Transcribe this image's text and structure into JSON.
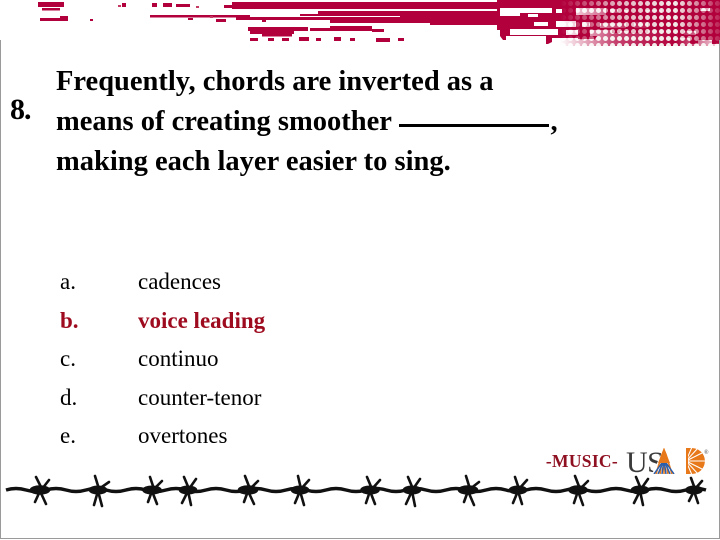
{
  "slide": {
    "number": "8.",
    "question_lines": [
      "Frequently, chords are inverted as a",
      "means of creating smoother ",
      "making each layer easier to sing."
    ],
    "question_line2_suffix": ",",
    "blank_placeholder": "______"
  },
  "choices": [
    {
      "letter": "a.",
      "text": "cadences",
      "correct": false
    },
    {
      "letter": "b.",
      "text": "voice leading",
      "correct": true
    },
    {
      "letter": "c.",
      "text": "continuo",
      "correct": false
    },
    {
      "letter": "d.",
      "text": "counter-tenor",
      "correct": false
    },
    {
      "letter": "e.",
      "text": "overtones",
      "correct": false
    }
  ],
  "branding": {
    "subject_tag": "-MUSIC-",
    "logo_text_us": "US",
    "logo_letter_a": "A",
    "logo_letter_d": "D",
    "logo_trademark": "®"
  },
  "colors": {
    "banner_red": "#b2003c",
    "answer_red": "#9e0b1f",
    "subject_red": "#8e1021",
    "logo_orange": "#e8791a",
    "logo_blue": "#2b5eaa",
    "logo_dark": "#3a3a3a",
    "text_black": "#000000",
    "frame_gray": "#9a9a9a"
  }
}
